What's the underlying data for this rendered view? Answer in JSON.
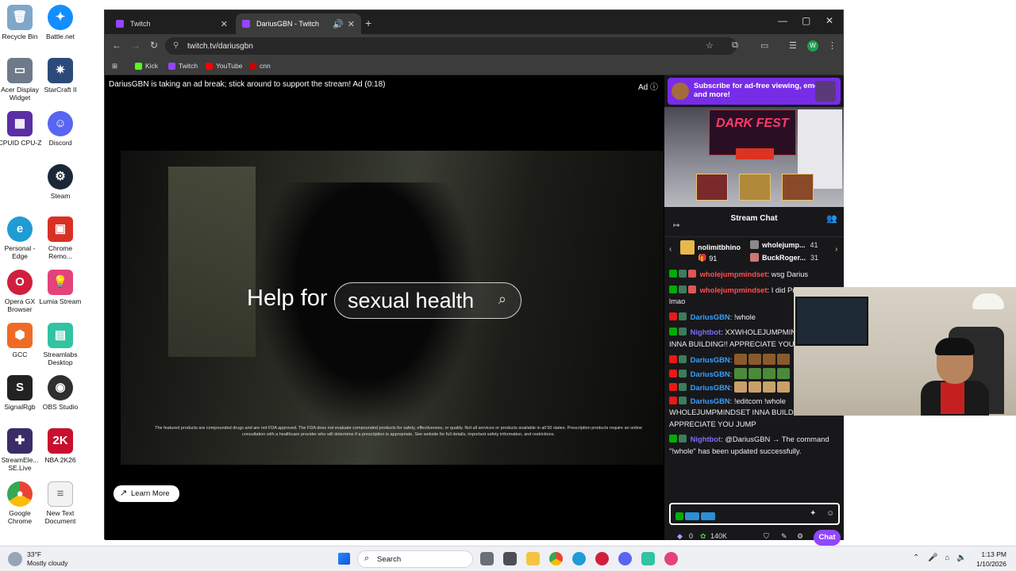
{
  "desktop": {
    "icons": [
      {
        "label": "Recycle Bin",
        "color": "#7fa7c9"
      },
      {
        "label": "Battle.net",
        "color": "#148eff"
      },
      {
        "label": "Acer Display Widget",
        "color": "#6e7a8a"
      },
      {
        "label": "StarCraft II",
        "color": "#2b4a7a"
      },
      {
        "label": "CPUID CPU-Z",
        "color": "#5b2ea6"
      },
      {
        "label": "Discord",
        "color": "#5865f2"
      },
      {
        "label": "Steam",
        "color": "#1b2838"
      },
      {
        "label": "Personal - Edge",
        "color": "#1f9bd6"
      },
      {
        "label": "Chrome Remo...",
        "color": "#d93025"
      },
      {
        "label": "Opera GX Browser",
        "color": "#d01f3c"
      },
      {
        "label": "Lumia Stream",
        "color": "#e4427a"
      },
      {
        "label": "GCC",
        "color": "#ef6b25"
      },
      {
        "label": "Streamlabs Desktop",
        "color": "#31c3a2"
      },
      {
        "label": "SignalRgb",
        "color": "#222222"
      },
      {
        "label": "OBS Studio",
        "color": "#302e31"
      },
      {
        "label": "StreamEle... SE.Live",
        "color": "#3a2c66"
      },
      {
        "label": "NBA 2K26",
        "color": "#c8102e"
      },
      {
        "label": "Google Chrome",
        "color": "#34a853"
      },
      {
        "label": "New Text Document",
        "color": "#f2f2f2"
      }
    ]
  },
  "browser": {
    "tabs": [
      {
        "label": "Twitch"
      },
      {
        "label": "DariusGBN - Twitch"
      }
    ],
    "url": "twitch.tv/dariusgbn",
    "profile_initial": "W",
    "bookmarks": [
      {
        "label": "Kick",
        "color": "#53fc18"
      },
      {
        "label": "Twitch",
        "color": "#9146ff"
      },
      {
        "label": "YouTube",
        "color": "#ff0000"
      },
      {
        "label": "cnn",
        "color": "#cc0000"
      }
    ]
  },
  "player": {
    "ad_banner": "DariusGBN is taking an ad break; stick around to support the stream! Ad (0:18)",
    "ad_label": "Ad",
    "ad_headline": "Help for",
    "ad_search_text": "sexual health",
    "disclaimer": "The featured products are compounded drugs and are not FDA approved. The FDA does not evaluate compounded products for safety, effectiveness, or quality. Not all services or products available in all 50 states. Prescription products require an online consultation with a healthcare provider who will determine if a prescription is appropriate. See website for full details, important safety information, and restrictions.",
    "learn_more": "Learn More"
  },
  "panel": {
    "sub_banner": "Subscribe for ad-free viewing, emotes, and more!",
    "panel_logo": "DARK FEST",
    "chat_title": "Stream Chat",
    "gifters": [
      {
        "name": "nolimitbhino",
        "count": "91",
        "color": "#e9b84a"
      },
      {
        "name": "wholejump...",
        "count": "41",
        "color": "#8a8a8a"
      },
      {
        "name": "BuckRoger...",
        "count": "31",
        "color": "#c77"
      }
    ],
    "messages": [
      {
        "user": "wholejumpmindset",
        "color": "#ff4f4f",
        "text": ": wsg Darius"
      },
      {
        "user": "wholejumpmindset",
        "color": "#ff4f4f",
        "text": ": I did Preciate them lmao"
      },
      {
        "user": "DariusGBN",
        "color": "#3aa0ff",
        "text": ": !whole"
      },
      {
        "user": "Nightbot",
        "color": "#7b6cff",
        "text": ": XXWHOLEJUMPMINDSETXX INNA BUILDING!! APPRECIATE YOU JUMP"
      },
      {
        "user": "DariusGBN",
        "color": "#3aa0ff",
        "text": ":"
      },
      {
        "user": "DariusGBN",
        "color": "#3aa0ff",
        "text": ":"
      },
      {
        "user": "DariusGBN",
        "color": "#3aa0ff",
        "text": ":"
      },
      {
        "user": "DariusGBN",
        "color": "#3aa0ff",
        "text": ": !editcom !whole WHOLEJUMPMINDSET INNA BUILDING!! APPRECIATE YOU JUMP"
      },
      {
        "user": "Nightbot",
        "color": "#7b6cff",
        "text": ": @DariusGBN → The command \"!whole\" has been updated successfully."
      }
    ],
    "footer_points": "0",
    "footer_channel_points": "140K",
    "chat_button": "Chat"
  },
  "taskbar": {
    "weather_temp": "33°F",
    "weather_cond": "Mostly cloudy",
    "search_label": "Search",
    "time": "1:13 PM",
    "date": "1/10/2026"
  }
}
